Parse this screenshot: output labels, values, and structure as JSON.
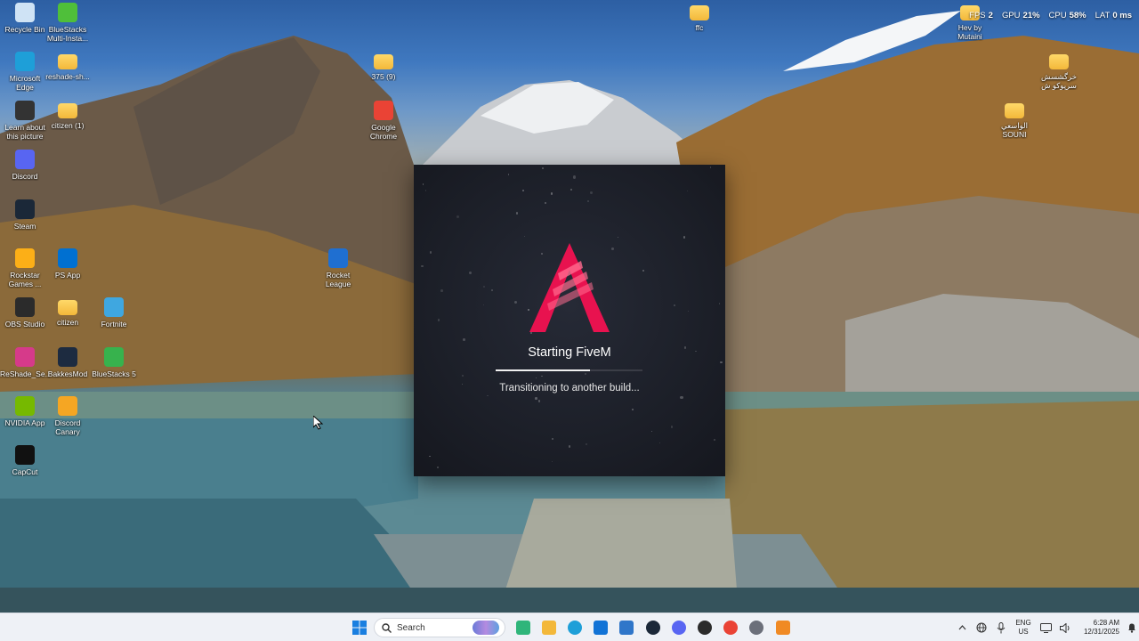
{
  "desktop": {
    "icons": [
      {
        "label": "Recycle Bin",
        "icon": "recycle-bin-icon",
        "color": "#cfe3f5"
      },
      {
        "label": "BlueStacks Multi-Insta...",
        "icon": "bluestacks-multi-instance-icon",
        "color": "#4fbf3a"
      },
      {
        "label": "Microsoft Edge",
        "icon": "edge-icon",
        "color": "#1e9fd8"
      },
      {
        "label": "reshade-sh...",
        "icon": "folder-icon",
        "color": "#f3c24a"
      },
      {
        "label": "Learn about this picture",
        "icon": "learn-about-picture-icon",
        "color": "#333333"
      },
      {
        "label": "citizen (1)",
        "icon": "folder-icon",
        "color": "#f3c24a"
      },
      {
        "label": "Discord",
        "icon": "discord-icon",
        "color": "#5865f2"
      },
      {
        "label": "Steam",
        "icon": "steam-icon",
        "color": "#1b2838"
      },
      {
        "label": "Rockstar Games ...",
        "icon": "rockstar-icon",
        "color": "#fcaf17"
      },
      {
        "label": "PS App",
        "icon": "playstation-icon",
        "color": "#0070d1"
      },
      {
        "label": "OBS Studio",
        "icon": "obs-icon",
        "color": "#2b2b2b"
      },
      {
        "label": "citizen",
        "icon": "folder-icon",
        "color": "#f3c24a"
      },
      {
        "label": "Fortnite",
        "icon": "fortnite-icon",
        "color": "#3fa7e0"
      },
      {
        "label": "ReShade_Se...",
        "icon": "reshade-icon",
        "color": "#d63a8a"
      },
      {
        "label": "BakkesMod",
        "icon": "bakkesmod-icon",
        "color": "#1d2b40"
      },
      {
        "label": "BlueStacks 5",
        "icon": "bluestacks-icon",
        "color": "#37b24d"
      },
      {
        "label": "NVIDIA App",
        "icon": "nvidia-icon",
        "color": "#76b900"
      },
      {
        "label": "Discord Canary",
        "icon": "discord-canary-icon",
        "color": "#f5a623"
      },
      {
        "label": "CapCut",
        "icon": "capcut-icon",
        "color": "#111111"
      },
      {
        "label": "375 (9)",
        "icon": "folder-icon",
        "color": "#f3c24a"
      },
      {
        "label": "Google Chrome",
        "icon": "chrome-icon",
        "color": "#ea4335"
      },
      {
        "label": "Rocket League",
        "icon": "rocket-league-icon",
        "color": "#1f6fd1"
      },
      {
        "label": "ffc",
        "icon": "folder-icon",
        "color": "#f3c24a"
      },
      {
        "label": "Hev by Mutaini",
        "icon": "folder-icon",
        "color": "#f3c24a"
      },
      {
        "label": "خرگشسش سرپوکو ش",
        "icon": "folder-icon",
        "color": "#f3c24a"
      },
      {
        "label": "الواسعي SOUNI",
        "icon": "folder-icon",
        "color": "#f3c24a"
      }
    ]
  },
  "perf_overlay": {
    "fps_label": "FPS",
    "fps_value": "2",
    "gpu_label": "GPU",
    "gpu_value": "21%",
    "cpu_label": "CPU",
    "cpu_value": "58%",
    "lat_label": "LAT",
    "lat_value": "0 ms"
  },
  "splash": {
    "title": "Starting FiveM",
    "status": "Transitioning to another build...",
    "progress": 0.64,
    "accent": "#e8124f",
    "background": "#1e212b"
  },
  "taskbar": {
    "search_placeholder": "Search",
    "pinned": [
      {
        "icon": "copilot-icon",
        "color": "#2fb57a"
      },
      {
        "icon": "file-explorer-icon",
        "color": "#f3b83a"
      },
      {
        "icon": "edge-icon",
        "color": "#1e9fd8"
      },
      {
        "icon": "microsoft-store-icon",
        "color": "#1273d6"
      },
      {
        "icon": "outlook-icon",
        "color": "#2f76c9"
      },
      {
        "icon": "steam-icon",
        "color": "#1b2838"
      },
      {
        "icon": "discord-icon",
        "color": "#5865f2"
      },
      {
        "icon": "obs-icon",
        "color": "#2b2b2b"
      },
      {
        "icon": "chrome-icon",
        "color": "#ea4335"
      },
      {
        "icon": "settings-icon",
        "color": "#6b6f7a"
      },
      {
        "icon": "fivem-icon",
        "color": "#f08a24"
      }
    ],
    "tray": {
      "language_line1": "ENG",
      "language_line2": "US",
      "time": "6:28 AM",
      "date": "12/31/2025"
    }
  }
}
